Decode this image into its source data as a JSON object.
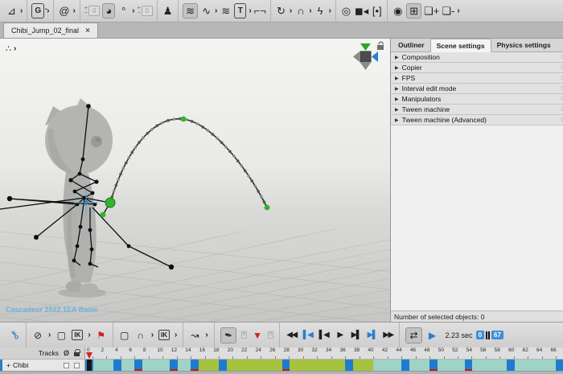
{
  "tab_bar": {
    "tab": {
      "label": "Chibi_Jump_02_final",
      "close": "×",
      "active": true
    }
  },
  "top_toolbar": {
    "groups": [
      [
        {
          "n": "axis-tool-icon",
          "g": "⊿",
          "arrow": true
        }
      ],
      [
        {
          "n": "global-mode-icon",
          "g": "G",
          "box": "outline",
          "badge": "▪",
          "arrow": true
        }
      ],
      [
        {
          "n": "spiral-tool-icon",
          "g": "@",
          "arrow": true
        }
      ],
      [
        {
          "n": "ghost-before-stepper",
          "stepper": true,
          "g": "0"
        },
        {
          "n": "ghosts-icon",
          "g": "◕",
          "box": "active"
        },
        {
          "n": "ghost-pin-icon",
          "g": "°",
          "arrow": true
        },
        {
          "n": "ghost-after-stepper",
          "stepper": true,
          "g": "0"
        }
      ],
      [
        {
          "n": "character-icon",
          "g": "♟"
        }
      ],
      [
        {
          "n": "interpolation-waves-icon",
          "g": "≋",
          "box": "active"
        },
        {
          "n": "tween-wave-icon",
          "g": "∿",
          "arrow": true
        },
        {
          "n": "secondary-motion-icon",
          "g": "≋"
        },
        {
          "n": "trajectory-tool-icon",
          "g": "T",
          "box": "outline",
          "arrow": true
        },
        {
          "n": "corner-brackets-icon",
          "g": "⌐¬"
        }
      ],
      [
        {
          "n": "rotate-loop-icon",
          "g": "↻",
          "arrow": true
        },
        {
          "n": "camera-arc-icon",
          "g": "∩",
          "arrow": true
        },
        {
          "n": "run-cycle-icon",
          "g": "ϟ",
          "arrow": true
        }
      ],
      [
        {
          "n": "physics-target-icon",
          "g": "◎"
        },
        {
          "n": "camera-icon",
          "g": "◼◂"
        },
        {
          "n": "focus-brackets-icon",
          "g": "[•]"
        }
      ],
      [
        {
          "n": "spiral-overlay-icon",
          "g": "◉"
        },
        {
          "n": "grid-snap-icon",
          "g": "⊞",
          "box": "active"
        },
        {
          "n": "layer-add-icon",
          "g": "❏+"
        },
        {
          "n": "layer-remove-icon",
          "g": "❏-",
          "arrow": true
        }
      ]
    ]
  },
  "viewport": {
    "watermark": "Cascadeur 2022.1EA Basic",
    "corner_icon": "∴",
    "corner_arrow": "›"
  },
  "right_panel": {
    "tabs": [
      {
        "label": "Outliner",
        "active": false
      },
      {
        "label": "Scene settings",
        "active": true
      },
      {
        "label": "Physics settings",
        "active": false
      }
    ],
    "sections": [
      "Composition",
      "Copier",
      "FPS",
      "Interval edit mode",
      "Manipulators",
      "Tween machine",
      "Tween machine (Advanced)"
    ],
    "section_arrow": "▶",
    "grip": "⁞⁞",
    "status": "Number of selected objects: 0"
  },
  "bottom_toolbar": {
    "groups": [
      [
        {
          "n": "autokey-icon",
          "g": "⚷",
          "cls": "c-blue key"
        }
      ],
      [
        {
          "n": "no-physics-icon",
          "g": "⊘",
          "arrow": true
        },
        {
          "n": "selection-frame-icon",
          "g": "▢"
        },
        {
          "n": "ik-fk-mode-icon",
          "g": "IK",
          "box": "outline",
          "arrow": true
        },
        {
          "n": "flag-icon",
          "g": "⚑",
          "cls": "c-red"
        }
      ],
      [
        {
          "n": "selection-frame2-icon",
          "g": "▢"
        },
        {
          "n": "trajectory-arc-icon",
          "g": "∩",
          "arrow": true
        },
        {
          "n": "ik-interval-icon",
          "g": "IK",
          "box": "outline",
          "arrow": true
        }
      ],
      [
        {
          "n": "step-interpolation-icon",
          "g": "↝",
          "arrow": true
        }
      ],
      [
        {
          "n": "pin-icon",
          "g": "✒",
          "box": "active",
          "cls": "pin"
        },
        {
          "n": "filter-funnel-icon",
          "g": "▼",
          "cls": "c-red",
          "pre": "0",
          "post": "0"
        }
      ],
      [
        {
          "n": "rewind-button",
          "g": "◀◀",
          "cls": "transport"
        },
        {
          "n": "jump-to-start-button",
          "g": "▌◀",
          "cls": "transport c-blue"
        },
        {
          "n": "prev-frame-button",
          "g": "▌◀",
          "cls": "transport"
        },
        {
          "n": "play-button",
          "g": "▶",
          "cls": "transport"
        },
        {
          "n": "next-frame-button",
          "g": "▶▌",
          "cls": "transport"
        },
        {
          "n": "jump-to-end-button",
          "g": "▶▌",
          "cls": "transport c-blue"
        },
        {
          "n": "fast-forward-button",
          "g": "▶▶",
          "cls": "transport"
        }
      ],
      [
        {
          "n": "loop-playback-button",
          "g": "⇄",
          "box": "active"
        },
        {
          "n": "playblast-button",
          "g": "▶",
          "cls": "c-blue"
        }
      ]
    ],
    "time_label": "2.23 sec",
    "range_start": "0",
    "range_end": "67"
  },
  "timeline": {
    "tracks_label": "Tracks",
    "eye_icon": "Ø",
    "track": {
      "expand": "+",
      "name": "Chibi"
    },
    "frame_count": 68,
    "label_step": 2,
    "current_frame": 0,
    "segments": [
      {
        "from": 1,
        "to": 15,
        "color": "teal"
      },
      {
        "from": 16,
        "to": 40,
        "color": "green"
      },
      {
        "from": 41,
        "to": 67,
        "color": "teal"
      }
    ],
    "keyframes": [
      4,
      7,
      12,
      15,
      19,
      28,
      37,
      45,
      49,
      54,
      60,
      67
    ],
    "red_marks": [
      7,
      12,
      15,
      28,
      49,
      54
    ],
    "colors": {
      "teal": "#9fd3c6",
      "green": "#a6c23e",
      "keyframe": "#1e7cd0",
      "red_mark": "#cc1a00",
      "current_bg": "#151515",
      "current_border": "#2e7cc4"
    }
  }
}
